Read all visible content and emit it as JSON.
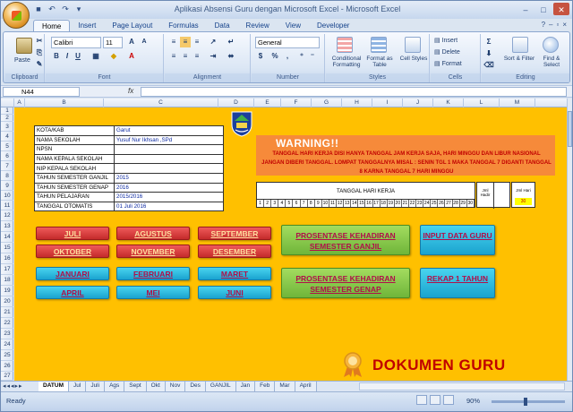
{
  "window": {
    "title": "Aplikasi Absensi Guru dengan Microsoft Excel - Microsoft Excel"
  },
  "ribbon_tabs": [
    "Home",
    "Insert",
    "Page Layout",
    "Formulas",
    "Data",
    "Review",
    "View",
    "Developer"
  ],
  "ribbon": {
    "clipboard": {
      "label": "Clipboard",
      "paste": "Paste"
    },
    "font": {
      "label": "Font",
      "name": "Calibri",
      "size": "11",
      "bold": "B",
      "italic": "I",
      "underline": "U"
    },
    "alignment": {
      "label": "Alignment"
    },
    "number": {
      "label": "Number",
      "format": "General",
      "percent": "%",
      "comma": ","
    },
    "styles": {
      "label": "Styles",
      "conditional": "Conditional Formatting",
      "format_table": "Format as Table",
      "cell_styles": "Cell Styles"
    },
    "cells": {
      "label": "Cells",
      "insert": "Insert",
      "delete": "Delete",
      "format": "Format"
    },
    "editing": {
      "label": "Editing",
      "sort": "Sort & Filter",
      "find": "Find & Select"
    }
  },
  "formula_bar": {
    "name_box": "N44",
    "fx": "fx",
    "value": ""
  },
  "columns": [
    "A",
    "B",
    "C",
    "D",
    "E",
    "F",
    "G",
    "H",
    "I",
    "J",
    "K",
    "L",
    "M"
  ],
  "rows": [
    "1",
    "2",
    "3",
    "4",
    "5",
    "6",
    "7",
    "8",
    "9",
    "10",
    "11",
    "12",
    "13",
    "14",
    "15",
    "16",
    "17",
    "18",
    "19",
    "20",
    "21",
    "22",
    "23",
    "24",
    "25",
    "26",
    "27"
  ],
  "info_table": [
    {
      "key": "KOTA/KAB",
      "value": "Garut"
    },
    {
      "key": "NAMA SEKOLAH",
      "value": "Yusuf Nur Ikhsan ,SPd"
    },
    {
      "key": "NPSN",
      "value": ""
    },
    {
      "key": "NAMA KEPALA SEKOLAH",
      "value": ""
    },
    {
      "key": "NIP KEPALA SEKOLAH",
      "value": ""
    },
    {
      "key": "TAHUN SEMESTER GANJIL",
      "value": "2015"
    },
    {
      "key": "TAHUN SEMESTER GENAP",
      "value": "2016"
    },
    {
      "key": "TAHUN PELAJARAN",
      "value": "2015/2016"
    },
    {
      "key": "TANGGAL OTOMATIS",
      "value": "01 Juli 2016"
    }
  ],
  "warning": {
    "title": "WARNING!!",
    "body": "TANGGAL HARI KERJA DISI HANYA TANGGAL JAM KERJA SAJA, HARI MINGGU DAN LIBUR NASIONAL JANGAN DIBERI TANGGAL. LOMPAT TANGGALNYA MISAL : SENIN TGL 1 MAKA TANGGAL 7 DIGANTI TANGGAL 8 KARNA TANGGAL 7 HARI MINGGU"
  },
  "work_days": {
    "label": "TANGGAL HARI KERJA",
    "numbers": [
      "1",
      "2",
      "3",
      "4",
      "5",
      "6",
      "7",
      "8",
      "9",
      "10",
      "11",
      "12",
      "13",
      "14",
      "15",
      "16",
      "17",
      "18",
      "19",
      "20",
      "21",
      "22",
      "23",
      "24",
      "25",
      "26",
      "27",
      "28",
      "29",
      "30"
    ],
    "hadir_label": "Jml Hadir",
    "hari_label": "Jml Hari",
    "hari_value": "30"
  },
  "months": {
    "juli": "JULI",
    "agustus": "AGUSTUS",
    "september": "SEPTEMBER",
    "oktober": "OKTOBER",
    "november": "NOVEMBER",
    "desember": "DESEMBER",
    "januari": "JANUARI",
    "februari": "FEBRUARI",
    "maret": "MARET",
    "april": "APRIL",
    "mei": "MEI",
    "juni": "JUNI"
  },
  "actions": {
    "ganjil": "PROSENTASE KEHADIRAN SEMESTER GANJIL",
    "genap": "PROSENTASE KEHADIRAN SEMESTER GENAP",
    "input": "INPUT DATA GURU",
    "rekap": "REKAP 1 TAHUN"
  },
  "brand": {
    "text": "DOKUMEN GURU"
  },
  "sheet_tabs": [
    "DATUM",
    "Jul",
    "Juli",
    "Ags",
    "Sept",
    "Okt",
    "Nov",
    "Des",
    "GANJIL",
    "Jan",
    "Feb",
    "Mar",
    "April"
  ],
  "status": {
    "ready": "Ready",
    "zoom": "90%"
  },
  "colors": {
    "sheet_bg": "#ffc000",
    "warning_bg": "#f68a3a",
    "red_btn": "#d83b3b",
    "cyan_btn": "#2bb8e0",
    "green_btn": "#86c84a",
    "brand": "#c00000"
  }
}
